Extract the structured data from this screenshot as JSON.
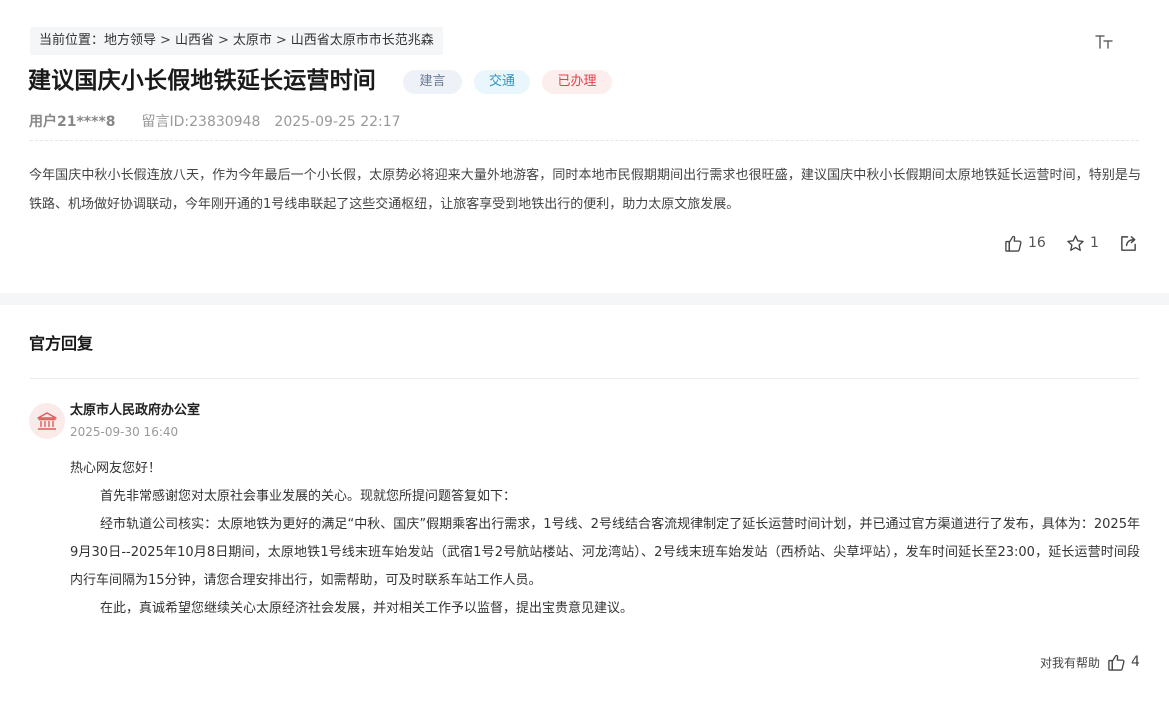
{
  "breadcrumb": {
    "prefix": "当前位置：",
    "items": [
      "地方领导",
      "山西省",
      "太原市",
      "山西省太原市市长范兆森"
    ],
    "separator": ">"
  },
  "post": {
    "title": "建议国庆小长假地铁延长运营时间",
    "tags": [
      "建言",
      "交通",
      "已办理"
    ],
    "user": "用户21****8",
    "message_id": "留言ID:23830948",
    "datetime": "2025-09-25 22:17",
    "content": "今年国庆中秋小长假连放八天，作为今年最后一个小长假，太原势必将迎来大量外地游客，同时本地市民假期期间出行需求也很旺盛，建议国庆中秋小长假期间太原地铁延长运营时间，特别是与铁路、机场做好协调联动，今年刚开通的1号线串联起了这些交通枢纽，让旅客享受到地铁出行的便利，助力太原文旅发展。",
    "likes": "16",
    "favorites": "1"
  },
  "reply": {
    "heading": "官方回复",
    "org_name": "太原市人民政府办公室",
    "datetime": "2025-09-30 16:40",
    "greeting": "热心网友您好！",
    "paragraphs": [
      "首先非常感谢您对太原社会事业发展的关心。现就您所提问题答复如下：",
      "经市轨道公司核实：太原地铁为更好的满足“中秋、国庆”假期乘客出行需求，1号线、2号线结合客流规律制定了延长运营时间计划，并已通过官方渠道进行了发布，具体为：2025年9月30日--2025年10月8日期间，太原地铁1号线末班车始发站（武宿1号2号航站楼站、河龙湾站）、2号线末班车始发站（西桥站、尖草坪站），发车时间延长至23:00，延长运营时间段内行车间隔为15分钟，请您合理安排出行，如需帮助，可及时联系车站工作人员。",
      "在此，真诚希望您继续关心太原经济社会发展，并对相关工作予以监督，提出宝贵意见建议。"
    ],
    "helpful_label": "对我有帮助",
    "helpful_count": "4"
  },
  "icons": {
    "font_size": "font-size-icon",
    "like": "thumbs-up-icon",
    "favorite": "star-icon",
    "share": "share-icon",
    "org": "government-building-icon"
  },
  "colors": {
    "tag_suggestion": "#6b7a96",
    "tag_traffic": "#2f93c2",
    "tag_done": "#e0414a",
    "org_icon": "#e05b5b"
  }
}
